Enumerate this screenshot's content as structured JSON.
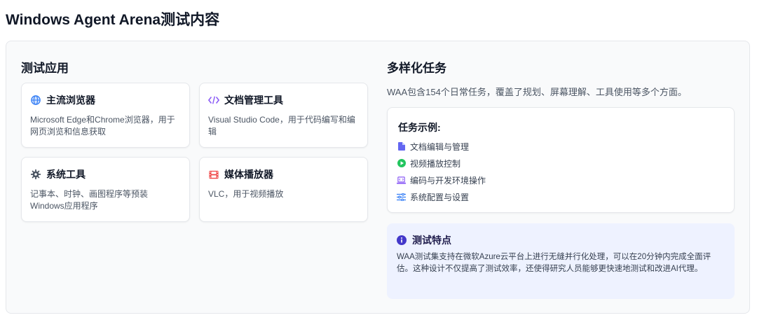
{
  "page": {
    "title": "Windows Agent Arena测试内容"
  },
  "apps_section": {
    "heading": "测试应用",
    "cards": [
      {
        "title": "主流浏览器",
        "desc": "Microsoft Edge和Chrome浏览器，用于网页浏览和信息获取",
        "icon": "globe-icon"
      },
      {
        "title": "文档管理工具",
        "desc": "Visual Studio Code，用于代码编写和编辑",
        "icon": "code-icon"
      },
      {
        "title": "系统工具",
        "desc": "记事本、时钟、画图程序等预装Windows应用程序",
        "icon": "gear-icon"
      },
      {
        "title": "媒体播放器",
        "desc": "VLC，用于视频播放",
        "icon": "film-icon"
      }
    ]
  },
  "tasks_section": {
    "heading": "多样化任务",
    "intro": "WAA包含154个日常任务，覆盖了规划、屏幕理解、工具使用等多个方面。",
    "examples_title": "任务示例:",
    "examples": [
      {
        "label": "文档编辑与管理",
        "icon": "document-icon"
      },
      {
        "label": "视频播放控制",
        "icon": "play-icon"
      },
      {
        "label": "编码与开发环境操作",
        "icon": "laptop-code-icon"
      },
      {
        "label": "系统配置与设置",
        "icon": "sliders-icon"
      }
    ]
  },
  "feature": {
    "title": "测试特点",
    "text": "WAA测试集支持在微软Azure云平台上进行无缝并行化处理，可以在20分钟内完成全面评估。这种设计不仅提高了测试效率，还使得研究人员能够更快速地测试和改进AI代理。",
    "icon": "info-icon"
  },
  "colors": {
    "blue": "#3b82f6",
    "purple": "#8b5cf6",
    "gray": "#4b5563",
    "red": "#ef4444",
    "green": "#22c55e",
    "indigo_bg": "#eef2ff"
  }
}
